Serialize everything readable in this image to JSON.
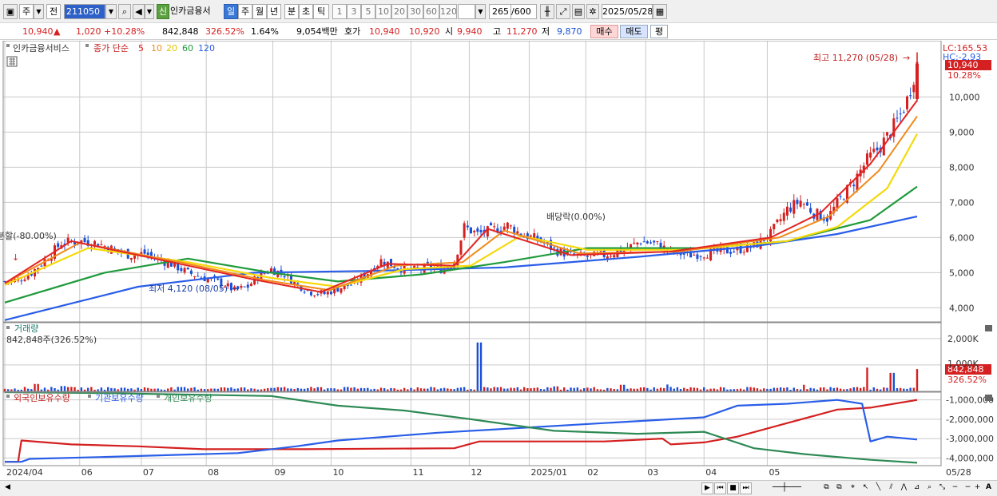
{
  "toolbar": {
    "market_label": "주",
    "prev_label": "전",
    "stock_code": "211050",
    "stock_name": "인카금융서",
    "new_badge": "신",
    "period_day": "일",
    "period_week": "주",
    "period_month": "월",
    "period_year": "년",
    "period_minute": "분",
    "period_second": "초",
    "period_tick": "틱",
    "interval_1": "1",
    "interval_3": "3",
    "interval_5": "5",
    "interval_10": "10",
    "interval_20": "20",
    "interval_30": "30",
    "interval_60": "60",
    "interval_120": "120",
    "count_value": "265",
    "count_max": "/600",
    "date_value": "2025/05/28"
  },
  "info": {
    "price": "10,940",
    "change_arrow": "▲",
    "change": "1,020",
    "change_pct": "+10.28%",
    "volume": "842,848",
    "volume_ratio": "326.52%",
    "turnover": "1.64%",
    "amount": "9,054백만",
    "quote_label": "호가",
    "ask": "10,940",
    "bid": "10,920",
    "open_label": "시",
    "open": "9,940",
    "high_label": "고",
    "high": "11,270",
    "low_label": "저",
    "low": "9,870",
    "buy_label": "매수",
    "sell_label": "매도",
    "avg_label": "평"
  },
  "legend": {
    "stock": "인카금융서비스",
    "ma_title": "종가 단순",
    "ma5": "5",
    "ma10": "10",
    "ma20": "20",
    "ma60": "60",
    "ma120": "120",
    "volume_title": "거래량",
    "volume_value": "842,848주(326.52%)",
    "holding_foreign": "외국인보유수량",
    "holding_inst": "기관보유수량",
    "holding_indiv": "개인보유수량"
  },
  "annotations": {
    "lc": "LC:165.53",
    "hc": "HC:-2.93",
    "price_tag": "10,940",
    "pct_tag": "10.28%",
    "high_note": "최고 11,270 (05/28)",
    "low_note": "최저 4,120 (08/05)",
    "split_note": "분할(-80.00%)",
    "dividend_note": "배당락(0.00%)",
    "volume_tag": "842,848",
    "volume_pct_tag": "326.52%",
    "vol_axis_1000k": "1,000K"
  },
  "chart_data": [
    {
      "type": "candlestick",
      "title": "인카금융서비스",
      "x_ticks": [
        "2024/04",
        "06",
        "07",
        "08",
        "09",
        "10",
        "11",
        "12",
        "2025/01",
        "02",
        "03",
        "04",
        "05",
        "05/28"
      ],
      "y_ticks": [
        "4,000",
        "5,000",
        "6,000",
        "7,000",
        "8,000",
        "9,000",
        "10,000"
      ],
      "ylim": [
        3600,
        11600
      ],
      "ohlc_close_path": [
        [
          0,
          4750
        ],
        [
          8,
          4800
        ],
        [
          16,
          5000
        ],
        [
          25,
          5400
        ],
        [
          34,
          5850
        ],
        [
          45,
          5900
        ],
        [
          55,
          5850
        ],
        [
          66,
          5650
        ],
        [
          75,
          5500
        ],
        [
          84,
          5550
        ],
        [
          92,
          5380
        ],
        [
          100,
          5250
        ],
        [
          110,
          5000
        ],
        [
          120,
          4850
        ],
        [
          130,
          4700
        ],
        [
          138,
          4500
        ],
        [
          146,
          4600
        ],
        [
          152,
          4900
        ],
        [
          160,
          5100
        ],
        [
          168,
          4950
        ],
        [
          176,
          4650
        ],
        [
          184,
          4450
        ],
        [
          192,
          4400
        ],
        [
          200,
          4550
        ],
        [
          210,
          4700
        ],
        [
          218,
          5000
        ],
        [
          226,
          5350
        ],
        [
          234,
          5200
        ],
        [
          242,
          5050
        ],
        [
          250,
          5100
        ],
        [
          256,
          5150
        ],
        [
          262,
          5100
        ],
        [
          270,
          5300
        ],
        [
          276,
          6300
        ],
        [
          284,
          6100
        ],
        [
          292,
          6200
        ],
        [
          302,
          6350
        ],
        [
          310,
          6100
        ],
        [
          320,
          5950
        ],
        [
          330,
          5650
        ],
        [
          340,
          5500
        ],
        [
          350,
          5450
        ],
        [
          360,
          5500
        ],
        [
          372,
          5650
        ],
        [
          382,
          5900
        ],
        [
          392,
          5800
        ],
        [
          400,
          5600
        ],
        [
          410,
          5500
        ],
        [
          420,
          5550
        ],
        [
          430,
          5600
        ],
        [
          440,
          5650
        ],
        [
          450,
          5750
        ],
        [
          460,
          6100
        ],
        [
          470,
          6800
        ],
        [
          478,
          7050
        ],
        [
          486,
          6700
        ],
        [
          494,
          6550
        ],
        [
          502,
          7100
        ],
        [
          510,
          7600
        ],
        [
          518,
          8200
        ],
        [
          526,
          8600
        ],
        [
          532,
          9000
        ],
        [
          538,
          9500
        ],
        [
          542,
          9920
        ],
        [
          548,
          10940
        ]
      ],
      "ma5": [
        [
          0,
          4700
        ],
        [
          40,
          5900
        ],
        [
          100,
          5300
        ],
        [
          150,
          4800
        ],
        [
          190,
          4450
        ],
        [
          230,
          5250
        ],
        [
          270,
          5200
        ],
        [
          290,
          6250
        ],
        [
          340,
          5500
        ],
        [
          400,
          5600
        ],
        [
          460,
          6000
        ],
        [
          490,
          6700
        ],
        [
          520,
          8100
        ],
        [
          548,
          9900
        ]
      ],
      "ma10": [
        [
          0,
          4700
        ],
        [
          45,
          5850
        ],
        [
          105,
          5300
        ],
        [
          155,
          4800
        ],
        [
          195,
          4500
        ],
        [
          235,
          5200
        ],
        [
          275,
          5300
        ],
        [
          300,
          6200
        ],
        [
          345,
          5550
        ],
        [
          405,
          5600
        ],
        [
          465,
          6000
        ],
        [
          495,
          6600
        ],
        [
          525,
          7900
        ],
        [
          548,
          9450
        ]
      ],
      "ma20": [
        [
          0,
          4650
        ],
        [
          50,
          5700
        ],
        [
          110,
          5300
        ],
        [
          160,
          4850
        ],
        [
          200,
          4600
        ],
        [
          240,
          5100
        ],
        [
          280,
          5200
        ],
        [
          310,
          6050
        ],
        [
          350,
          5650
        ],
        [
          410,
          5650
        ],
        [
          470,
          5900
        ],
        [
          500,
          6300
        ],
        [
          530,
          7400
        ],
        [
          548,
          8950
        ]
      ],
      "ma60": [
        [
          0,
          4150
        ],
        [
          60,
          5000
        ],
        [
          110,
          5400
        ],
        [
          160,
          5000
        ],
        [
          200,
          4750
        ],
        [
          250,
          4950
        ],
        [
          300,
          5300
        ],
        [
          350,
          5700
        ],
        [
          420,
          5700
        ],
        [
          470,
          5900
        ],
        [
          520,
          6500
        ],
        [
          548,
          7450
        ]
      ],
      "ma120": [
        [
          0,
          3650
        ],
        [
          80,
          4600
        ],
        [
          150,
          5000
        ],
        [
          220,
          5050
        ],
        [
          300,
          5150
        ],
        [
          380,
          5450
        ],
        [
          450,
          5750
        ],
        [
          500,
          6100
        ],
        [
          548,
          6600
        ]
      ],
      "high": {
        "label": "최고",
        "value": 11270,
        "date": "05/28"
      },
      "low": {
        "label": "최저",
        "value": 4120,
        "date": "08/05"
      }
    },
    {
      "type": "bar",
      "title": "거래량",
      "y_ticks": [
        "2,000K",
        "1,000K"
      ],
      "ylim": [
        0,
        2600
      ],
      "spikes_k": [
        [
          19,
          280
        ],
        [
          35,
          200
        ],
        [
          131,
          150
        ],
        [
          161,
          130
        ],
        [
          189,
          160
        ],
        [
          285,
          1850
        ],
        [
          331,
          190
        ],
        [
          371,
          250
        ],
        [
          398,
          260
        ],
        [
          480,
          250
        ],
        [
          518,
          900
        ],
        [
          533,
          700
        ],
        [
          548,
          842.848
        ]
      ]
    },
    {
      "type": "line",
      "title": "보유수량",
      "y_ticks": [
        "-1,000,000",
        "-2,000,000",
        "-3,000,000",
        "-4,000,000"
      ],
      "ylim": [
        -4400000,
        -600000
      ],
      "series": [
        {
          "name": "외국인보유수량",
          "color": "#d42020",
          "points": [
            [
              0,
              -4200000
            ],
            [
              8,
              -4200000
            ],
            [
              10,
              -3100000
            ],
            [
              40,
              -3300000
            ],
            [
              80,
              -3400000
            ],
            [
              120,
              -3550000
            ],
            [
              180,
              -3550000
            ],
            [
              270,
              -3500000
            ],
            [
              285,
              -3150000
            ],
            [
              360,
              -3150000
            ],
            [
              395,
              -3000000
            ],
            [
              400,
              -3300000
            ],
            [
              420,
              -3200000
            ],
            [
              440,
              -2900000
            ],
            [
              470,
              -2200000
            ],
            [
              500,
              -1500000
            ],
            [
              520,
              -1400000
            ],
            [
              548,
              -1000000
            ]
          ]
        },
        {
          "name": "기관보유수량",
          "color": "#2a5ee8",
          "points": [
            [
              0,
              -4200000
            ],
            [
              10,
              -4200000
            ],
            [
              15,
              -4050000
            ],
            [
              60,
              -3950000
            ],
            [
              140,
              -3750000
            ],
            [
              175,
              -3400000
            ],
            [
              200,
              -3100000
            ],
            [
              260,
              -2700000
            ],
            [
              300,
              -2500000
            ],
            [
              360,
              -2200000
            ],
            [
              420,
              -1900000
            ],
            [
              440,
              -1300000
            ],
            [
              470,
              -1200000
            ],
            [
              500,
              -1000000
            ],
            [
              515,
              -1200000
            ],
            [
              520,
              -3150000
            ],
            [
              530,
              -2900000
            ],
            [
              548,
              -3050000
            ]
          ]
        },
        {
          "name": "개인보유수량",
          "color": "#2e8a55",
          "points": [
            [
              0,
              -600000
            ],
            [
              60,
              -650000
            ],
            [
              160,
              -800000
            ],
            [
              200,
              -1300000
            ],
            [
              240,
              -1550000
            ],
            [
              280,
              -2000000
            ],
            [
              330,
              -2600000
            ],
            [
              380,
              -2750000
            ],
            [
              420,
              -2650000
            ],
            [
              450,
              -3500000
            ],
            [
              480,
              -3800000
            ],
            [
              520,
              -4100000
            ],
            [
              548,
              -4250000
            ]
          ]
        }
      ]
    }
  ],
  "colors": {
    "up": "#d42020",
    "down": "#1a4fd6",
    "ma5": "#e32323",
    "ma10": "#f08a1c",
    "ma20": "#f5d90a",
    "ma60": "#1f9a3c",
    "ma120": "#2a5ee8"
  }
}
